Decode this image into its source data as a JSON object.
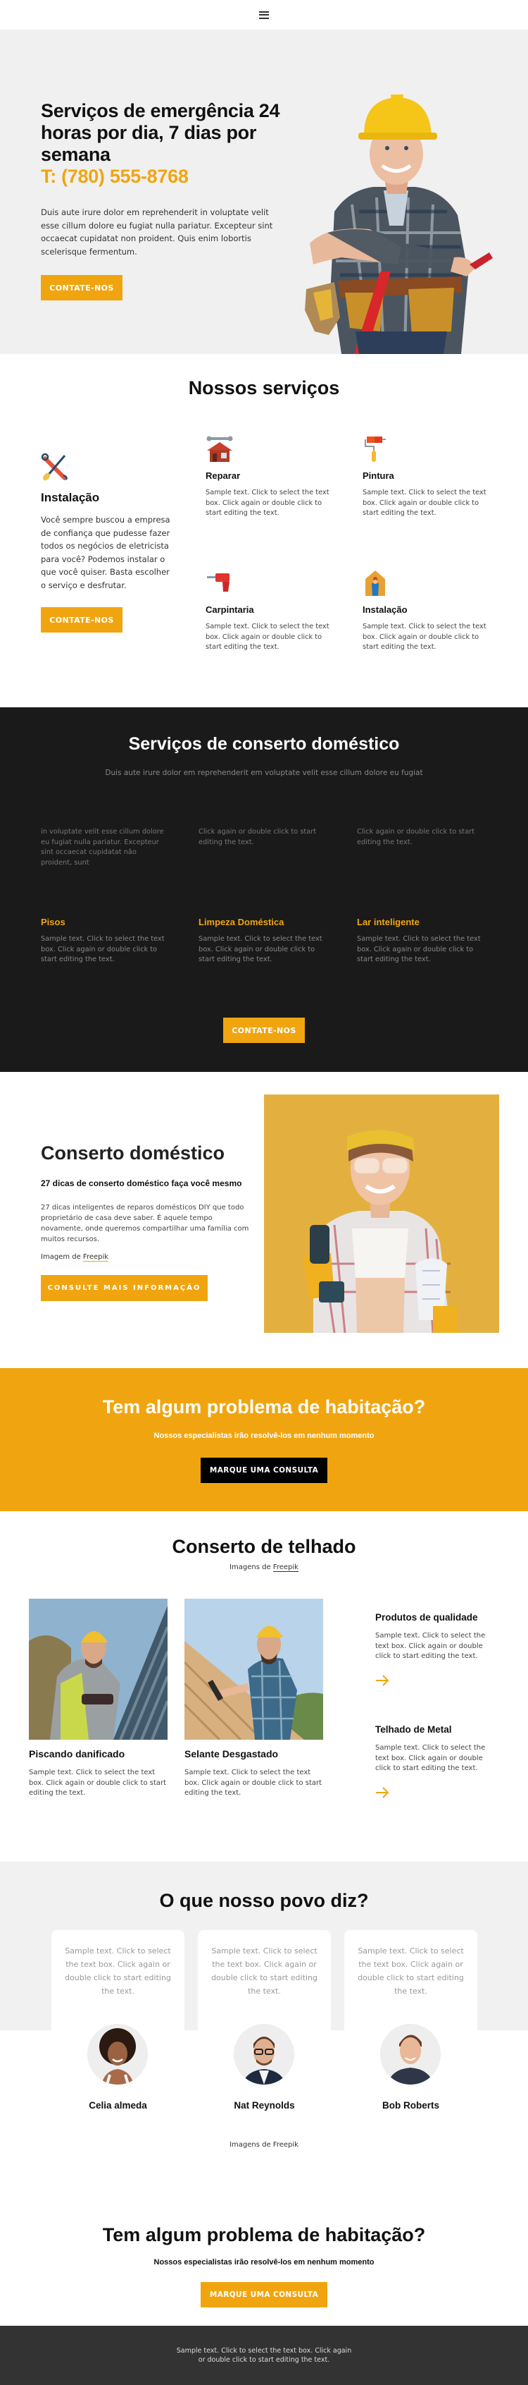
{
  "header": {
    "menu_icon": "hamburger-menu-icon"
  },
  "hero": {
    "title": "Serviços de emergência 24 horas por dia, 7 dias por semana",
    "phone": "T: (780) 555-8768",
    "description": "Duis aute irure dolor em reprehenderit in voluptate velit esse cillum dolore eu fugiat nulla pariatur. Excepteur sint occaecat cupidatat non proident. Quis enim lobortis scelerisque fermentum.",
    "button": "CONTATE-NOS",
    "image": "construction-worker-hardhat-photo"
  },
  "services": {
    "title": "Nossos serviços",
    "main": {
      "icon": "crossed-tools-icon",
      "title": "Instalação",
      "description": "Você sempre buscou a empresa de confiança que pudesse fazer todos os negócios de eletricista para você? Podemos instalar o que você quiser. Basta escolher o serviço e desfrutar.",
      "button": "CONTATE-NOS"
    },
    "items": [
      {
        "icon": "house-wrench-icon",
        "title": "Reparar",
        "description": "Sample text. Click to select the text box. Click again or double click to start editing the text."
      },
      {
        "icon": "paint-roller-icon",
        "title": "Pintura",
        "description": "Sample text. Click to select the text box. Click again or double click to start editing the text."
      },
      {
        "icon": "drill-icon",
        "title": "Carpintaria",
        "description": "Sample text. Click to select the text box. Click again or double click to start editing the text."
      },
      {
        "icon": "house-worker-icon",
        "title": "Instalação",
        "description": "Sample text. Click to select the text box. Click again or double click to start editing the text."
      }
    ]
  },
  "home_services": {
    "title": "Serviços de conserto doméstico",
    "subtitle": "Duis aute irure dolor em reprehenderit em voluptate velit esse cillum dolore eu fugiat",
    "top_row": [
      "in voluptate velit esse cillum dolore eu fugiat nulla pariatur. Excepteur sint occaecat cupidatat não proident, sunt",
      "Click again or double click to start editing the text.",
      "Click again or double click to start editing the text."
    ],
    "columns": [
      {
        "title": "Pisos",
        "description": "Sample text. Click to select the text box. Click again or double click to start editing the text."
      },
      {
        "title": "Limpeza Doméstica",
        "description": "Sample text. Click to select the text box. Click again or double click to start editing the text."
      },
      {
        "title": "Lar inteligente",
        "description": "Sample text. Click to select the text box. Click again or double click to start editing the text."
      }
    ],
    "button": "CONTATE-NOS",
    "accent_color": "#f0a510"
  },
  "home_repair": {
    "title": "Conserto doméstico",
    "subtitle": "27 dicas de conserto doméstico faça você mesmo",
    "description": "27 dicas inteligentes de reparos domésticos DIY que todo proprietário de casa deve saber. É aquele tempo novamente, onde queremos compartilhar uma família com muitos recursos.",
    "credit_prefix": "Imagem de ",
    "credit_link": "Freepik",
    "button": "CONSULTE MAIS INFORMAÇÃO",
    "image": "woman-with-drill-photo"
  },
  "banner": {
    "title": "Tem algum problema de habitação?",
    "subtitle": "Nossos especialistas irão resolvê-los em nenhum momento",
    "button": "MARQUE UMA CONSULTA",
    "background_color": "#f0a510"
  },
  "roof": {
    "title": "Conserto de telhado",
    "credit_prefix": "Imagens de ",
    "credit_link": "Freepik",
    "cards": [
      {
        "image": "worker-drilling-metal-roof-photo",
        "title": "Piscando danificado",
        "description": "Sample text. Click to select the text box. Click again or double click to start editing the text."
      },
      {
        "image": "worker-hammering-wood-roof-photo",
        "title": "Selante Desgastado",
        "description": "Sample text. Click to select the text box. Click again or double click to start editing the text."
      }
    ],
    "side": [
      {
        "title": "Produtos de qualidade",
        "description": "Sample text. Click to select the text box. Click again or double click to start editing the text.",
        "icon": "arrow-right-icon"
      },
      {
        "title": "Telhado de Metal",
        "description": "Sample text. Click to select the text box. Click again or double click to start editing the text.",
        "icon": "arrow-right-icon"
      }
    ]
  },
  "testimonials": {
    "title": "O que nosso povo diz?",
    "items": [
      {
        "text": "Sample text. Click to select the text box. Click again or double click to start editing the text.",
        "name": "Celia almeda",
        "avatar": "woman-curly-hair-avatar"
      },
      {
        "text": "Sample text. Click to select the text box. Click again or double click to start editing the text.",
        "name": "Nat Reynolds",
        "avatar": "man-glasses-avatar"
      },
      {
        "text": "Sample text. Click to select the text box. Click again or double click to start editing the text.",
        "name": "Bob Roberts",
        "avatar": "man-dark-shirt-avatar"
      }
    ],
    "credit_prefix": "Imagens de ",
    "credit_link": "Freepik"
  },
  "cta": {
    "title": "Tem algum problema de habitação?",
    "subtitle": "Nossos especialistas irão resolvê-los em nenhum momento",
    "button": "MARQUE UMA CONSULTA"
  },
  "footer": {
    "text": "Sample text. Click to select the text box. Click again or double click to start editing the text."
  }
}
